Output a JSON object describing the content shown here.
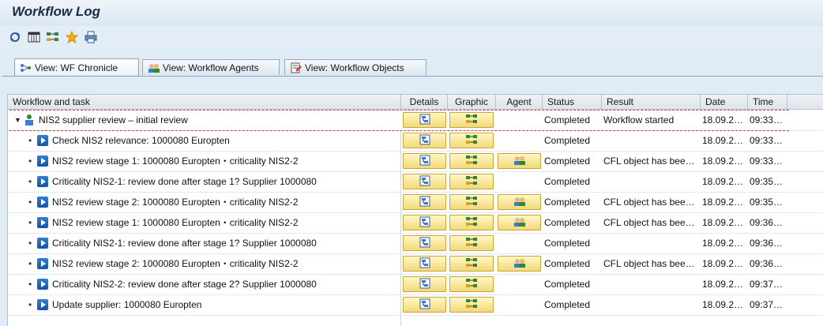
{
  "title": "Workflow Log",
  "toolbar": [
    {
      "name": "refresh-icon"
    },
    {
      "name": "columns-icon"
    },
    {
      "name": "hierarchy-icon"
    },
    {
      "name": "favorite-star-icon"
    },
    {
      "name": "print-icon"
    }
  ],
  "tabs": [
    {
      "label": "View: WF Chronicle",
      "icon": "chronicle-icon",
      "active": true
    },
    {
      "label": "View: Workflow Agents",
      "icon": "agents-icon",
      "active": false
    },
    {
      "label": "View: Workflow Objects",
      "icon": "objects-icon",
      "active": false
    }
  ],
  "columns": {
    "task": "Workflow and task",
    "details": "Details",
    "graphic": "Graphic",
    "agent": "Agent",
    "status": "Status",
    "result": "Result",
    "date": "Date",
    "time": "Time"
  },
  "rows": [
    {
      "task": "NIS2 supplier review – initial review",
      "root": true,
      "agent": false,
      "status": "Completed",
      "result": "Workflow started",
      "date": "18.09.2…",
      "time": "09:33…"
    },
    {
      "task": "Check NIS2 relevance: 1000080 Europten",
      "agent": false,
      "status": "Completed",
      "result": "",
      "date": "18.09.2…",
      "time": "09:33…"
    },
    {
      "task": "NIS2 review stage 1: 1000080 Europten・criticality NIS2-2",
      "agent": true,
      "status": "Completed",
      "result": "CFL object has bee…",
      "date": "18.09.2…",
      "time": "09:33…"
    },
    {
      "task": "Criticality NIS2-1: review done after stage 1? Supplier 1000080",
      "agent": false,
      "status": "Completed",
      "result": "",
      "date": "18.09.2…",
      "time": "09:35…"
    },
    {
      "task": "NIS2 review stage 2: 1000080 Europten・criticality NIS2-2",
      "agent": true,
      "status": "Completed",
      "result": "CFL object has bee…",
      "date": "18.09.2…",
      "time": "09:35…"
    },
    {
      "task": "NIS2 review stage 1: 1000080 Europten・criticality NIS2-2",
      "agent": true,
      "status": "Completed",
      "result": "CFL object has bee…",
      "date": "18.09.2…",
      "time": "09:36…"
    },
    {
      "task": "Criticality NIS2-1: review done after stage 1? Supplier 1000080",
      "agent": false,
      "status": "Completed",
      "result": "",
      "date": "18.09.2…",
      "time": "09:36…"
    },
    {
      "task": "NIS2 review stage 2: 1000080 Europten・criticality NIS2-2",
      "agent": true,
      "status": "Completed",
      "result": "CFL object has bee…",
      "date": "18.09.2…",
      "time": "09:36…"
    },
    {
      "task": "Criticality NIS2-2: review done after stage 2? Supplier 1000080",
      "agent": false,
      "status": "Completed",
      "result": "",
      "date": "18.09.2…",
      "time": "09:37…"
    },
    {
      "task": "Update supplier: 1000080 Europten",
      "agent": false,
      "status": "Completed",
      "result": "",
      "date": "18.09.2…",
      "time": "09:37…"
    }
  ],
  "colors": {
    "button_fill": "#f2d97a",
    "step_icon": "#1453a8",
    "background": "#dfebf5"
  }
}
